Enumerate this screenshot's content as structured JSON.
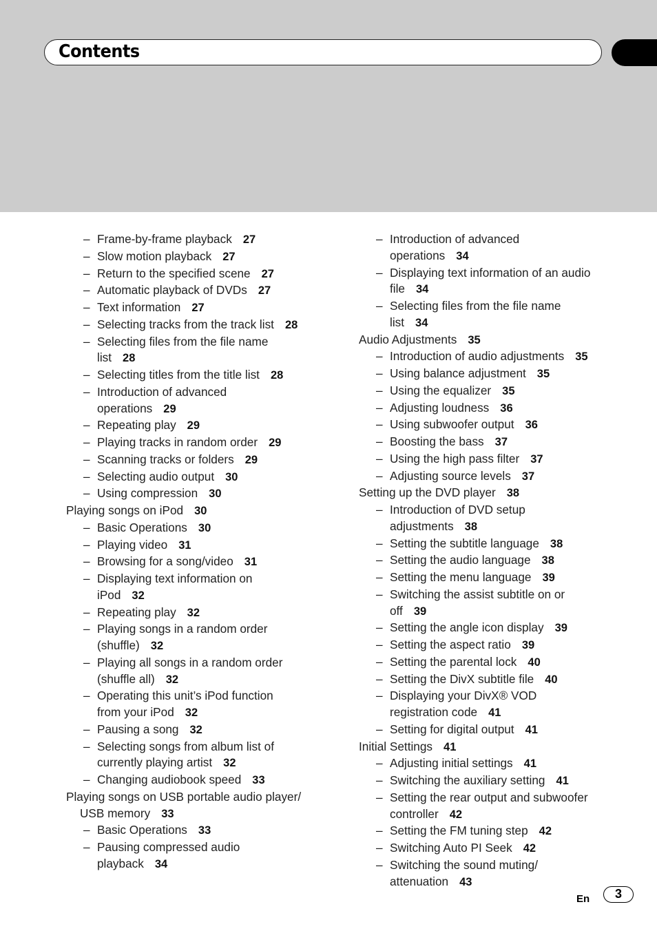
{
  "header": {
    "title": "Contents"
  },
  "columns": [
    {
      "entries": [
        {
          "level": "sub",
          "lines": [
            "Frame-by-frame playback"
          ],
          "page": "27"
        },
        {
          "level": "sub",
          "lines": [
            "Slow motion playback"
          ],
          "page": "27"
        },
        {
          "level": "sub",
          "lines": [
            "Return to the specified scene"
          ],
          "page": "27"
        },
        {
          "level": "sub",
          "lines": [
            "Automatic playback of DVDs"
          ],
          "page": "27"
        },
        {
          "level": "sub",
          "lines": [
            "Text information"
          ],
          "page": "27"
        },
        {
          "level": "sub",
          "lines": [
            "Selecting tracks from the track list"
          ],
          "page": "28"
        },
        {
          "level": "sub",
          "lines": [
            "Selecting files from the file name",
            "list"
          ],
          "page": "28"
        },
        {
          "level": "sub",
          "lines": [
            "Selecting titles from the title list"
          ],
          "page": "28"
        },
        {
          "level": "sub",
          "lines": [
            "Introduction of advanced",
            "operations"
          ],
          "page": "29"
        },
        {
          "level": "sub",
          "lines": [
            "Repeating play"
          ],
          "page": "29"
        },
        {
          "level": "sub",
          "lines": [
            "Playing tracks in random order"
          ],
          "page": "29"
        },
        {
          "level": "sub",
          "lines": [
            "Scanning tracks or folders"
          ],
          "page": "29"
        },
        {
          "level": "sub",
          "lines": [
            "Selecting audio output"
          ],
          "page": "30"
        },
        {
          "level": "sub",
          "lines": [
            "Using compression"
          ],
          "page": "30"
        },
        {
          "level": "top",
          "lines": [
            "Playing songs on iPod"
          ],
          "page": "30"
        },
        {
          "level": "sub",
          "lines": [
            "Basic Operations"
          ],
          "page": "30"
        },
        {
          "level": "sub",
          "lines": [
            "Playing video"
          ],
          "page": "31"
        },
        {
          "level": "sub",
          "lines": [
            "Browsing for a song/video"
          ],
          "page": "31"
        },
        {
          "level": "sub",
          "lines": [
            "Displaying text information on",
            "iPod"
          ],
          "page": "32"
        },
        {
          "level": "sub",
          "lines": [
            "Repeating play"
          ],
          "page": "32"
        },
        {
          "level": "sub",
          "lines": [
            "Playing songs in a random order",
            "(shuffle)"
          ],
          "page": "32"
        },
        {
          "level": "sub",
          "lines": [
            "Playing all songs in a random order",
            "(shuffle all)"
          ],
          "page": "32"
        },
        {
          "level": "sub",
          "lines": [
            "Operating this unit’s iPod function",
            "from your iPod"
          ],
          "page": "32"
        },
        {
          "level": "sub",
          "lines": [
            "Pausing a song"
          ],
          "page": "32"
        },
        {
          "level": "sub",
          "lines": [
            "Selecting songs from album list of",
            "currently playing artist"
          ],
          "page": "32"
        },
        {
          "level": "sub",
          "lines": [
            "Changing audiobook speed"
          ],
          "page": "33"
        },
        {
          "level": "top",
          "lines": [
            "Playing songs on USB portable audio player/",
            "USB memory"
          ],
          "page": "33"
        },
        {
          "level": "sub",
          "lines": [
            "Basic Operations"
          ],
          "page": "33"
        },
        {
          "level": "sub",
          "lines": [
            "Pausing compressed audio",
            "playback"
          ],
          "page": "34"
        }
      ]
    },
    {
      "entries": [
        {
          "level": "sub",
          "lines": [
            "Introduction of advanced",
            "operations"
          ],
          "page": "34"
        },
        {
          "level": "sub",
          "lines": [
            "Displaying text information of an audio",
            "file"
          ],
          "page": "34"
        },
        {
          "level": "sub",
          "lines": [
            "Selecting files from the file name",
            "list"
          ],
          "page": "34"
        },
        {
          "level": "top",
          "lines": [
            "Audio Adjustments"
          ],
          "page": "35"
        },
        {
          "level": "sub",
          "lines": [
            "Introduction of audio adjustments"
          ],
          "page": "35"
        },
        {
          "level": "sub",
          "lines": [
            "Using balance adjustment"
          ],
          "page": "35"
        },
        {
          "level": "sub",
          "lines": [
            "Using the equalizer"
          ],
          "page": "35"
        },
        {
          "level": "sub",
          "lines": [
            "Adjusting loudness"
          ],
          "page": "36"
        },
        {
          "level": "sub",
          "lines": [
            "Using subwoofer output"
          ],
          "page": "36"
        },
        {
          "level": "sub",
          "lines": [
            "Boosting the bass"
          ],
          "page": "37"
        },
        {
          "level": "sub",
          "lines": [
            "Using the high pass filter"
          ],
          "page": "37"
        },
        {
          "level": "sub",
          "lines": [
            "Adjusting source levels"
          ],
          "page": "37"
        },
        {
          "level": "top",
          "lines": [
            "Setting up the DVD player"
          ],
          "page": "38"
        },
        {
          "level": "sub",
          "lines": [
            "Introduction of DVD setup",
            "adjustments"
          ],
          "page": "38"
        },
        {
          "level": "sub",
          "lines": [
            "Setting the subtitle language"
          ],
          "page": "38"
        },
        {
          "level": "sub",
          "lines": [
            "Setting the audio language"
          ],
          "page": "38"
        },
        {
          "level": "sub",
          "lines": [
            "Setting the menu language"
          ],
          "page": "39"
        },
        {
          "level": "sub",
          "lines": [
            "Switching the assist subtitle on or",
            "off"
          ],
          "page": "39"
        },
        {
          "level": "sub",
          "lines": [
            "Setting the angle icon display"
          ],
          "page": "39"
        },
        {
          "level": "sub",
          "lines": [
            "Setting the aspect ratio"
          ],
          "page": "39"
        },
        {
          "level": "sub",
          "lines": [
            "Setting the parental lock"
          ],
          "page": "40"
        },
        {
          "level": "sub",
          "lines": [
            "Setting the DivX subtitle file"
          ],
          "page": "40"
        },
        {
          "level": "sub",
          "lines": [
            "Displaying your DivX® VOD",
            "registration code"
          ],
          "page": "41"
        },
        {
          "level": "sub",
          "lines": [
            "Setting for digital output"
          ],
          "page": "41"
        },
        {
          "level": "top",
          "lines": [
            "Initial Settings"
          ],
          "page": "41"
        },
        {
          "level": "sub",
          "lines": [
            "Adjusting initial settings"
          ],
          "page": "41"
        },
        {
          "level": "sub",
          "lines": [
            "Switching the auxiliary setting"
          ],
          "page": "41"
        },
        {
          "level": "sub",
          "lines": [
            "Setting the rear output and subwoofer",
            "controller"
          ],
          "page": "42"
        },
        {
          "level": "sub",
          "lines": [
            "Setting the FM tuning step"
          ],
          "page": "42"
        },
        {
          "level": "sub",
          "lines": [
            "Switching Auto PI Seek"
          ],
          "page": "42"
        },
        {
          "level": "sub",
          "lines": [
            "Switching the sound muting/",
            "attenuation"
          ],
          "page": "43"
        }
      ]
    }
  ],
  "footer": {
    "language": "En",
    "page_number": "3"
  },
  "dash_glyph": "–"
}
